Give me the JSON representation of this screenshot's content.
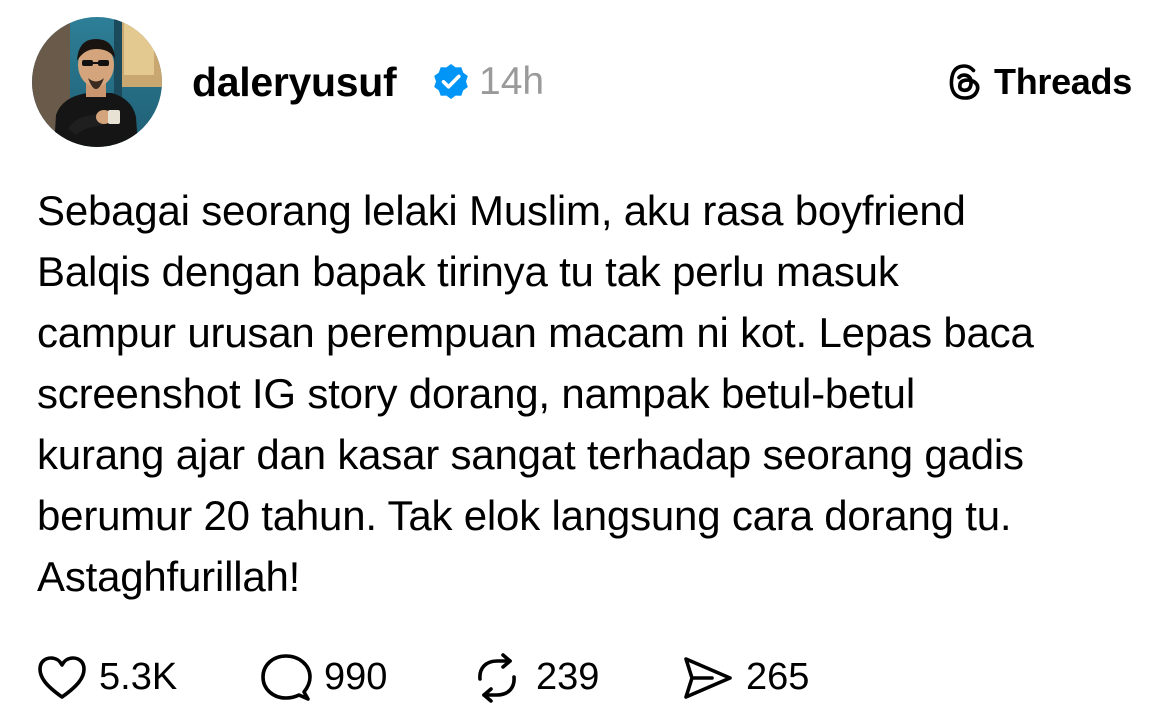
{
  "post": {
    "author": {
      "username": "daleryusuf",
      "verified": true,
      "avatar": "avatar-photo"
    },
    "time": "14h",
    "brand": {
      "label": "Threads",
      "icon": "threads-logo-icon"
    },
    "body": "Sebagai seorang lelaki Muslim, aku rasa boyfriend\nBalqis dengan bapak tirinya tu tak perlu masuk\ncampur urusan perempuan macam ni kot. Lepas baca\nscreenshot IG story dorang, nampak betul-betul\nkurang ajar dan kasar sangat terhadap seorang gadis\nberumur 20 tahun. Tak elok langsung cara dorang tu.\nAstaghfurillah!",
    "actions": {
      "like": {
        "icon": "heart-icon",
        "count": "5.3K"
      },
      "reply": {
        "icon": "comment-icon",
        "count": "990"
      },
      "repost": {
        "icon": "repost-icon",
        "count": "239"
      },
      "share": {
        "icon": "send-icon",
        "count": "265"
      }
    }
  },
  "colors": {
    "text": "#000000",
    "muted": "#9a9a9a",
    "verified": "#0095f6",
    "background": "#ffffff"
  }
}
